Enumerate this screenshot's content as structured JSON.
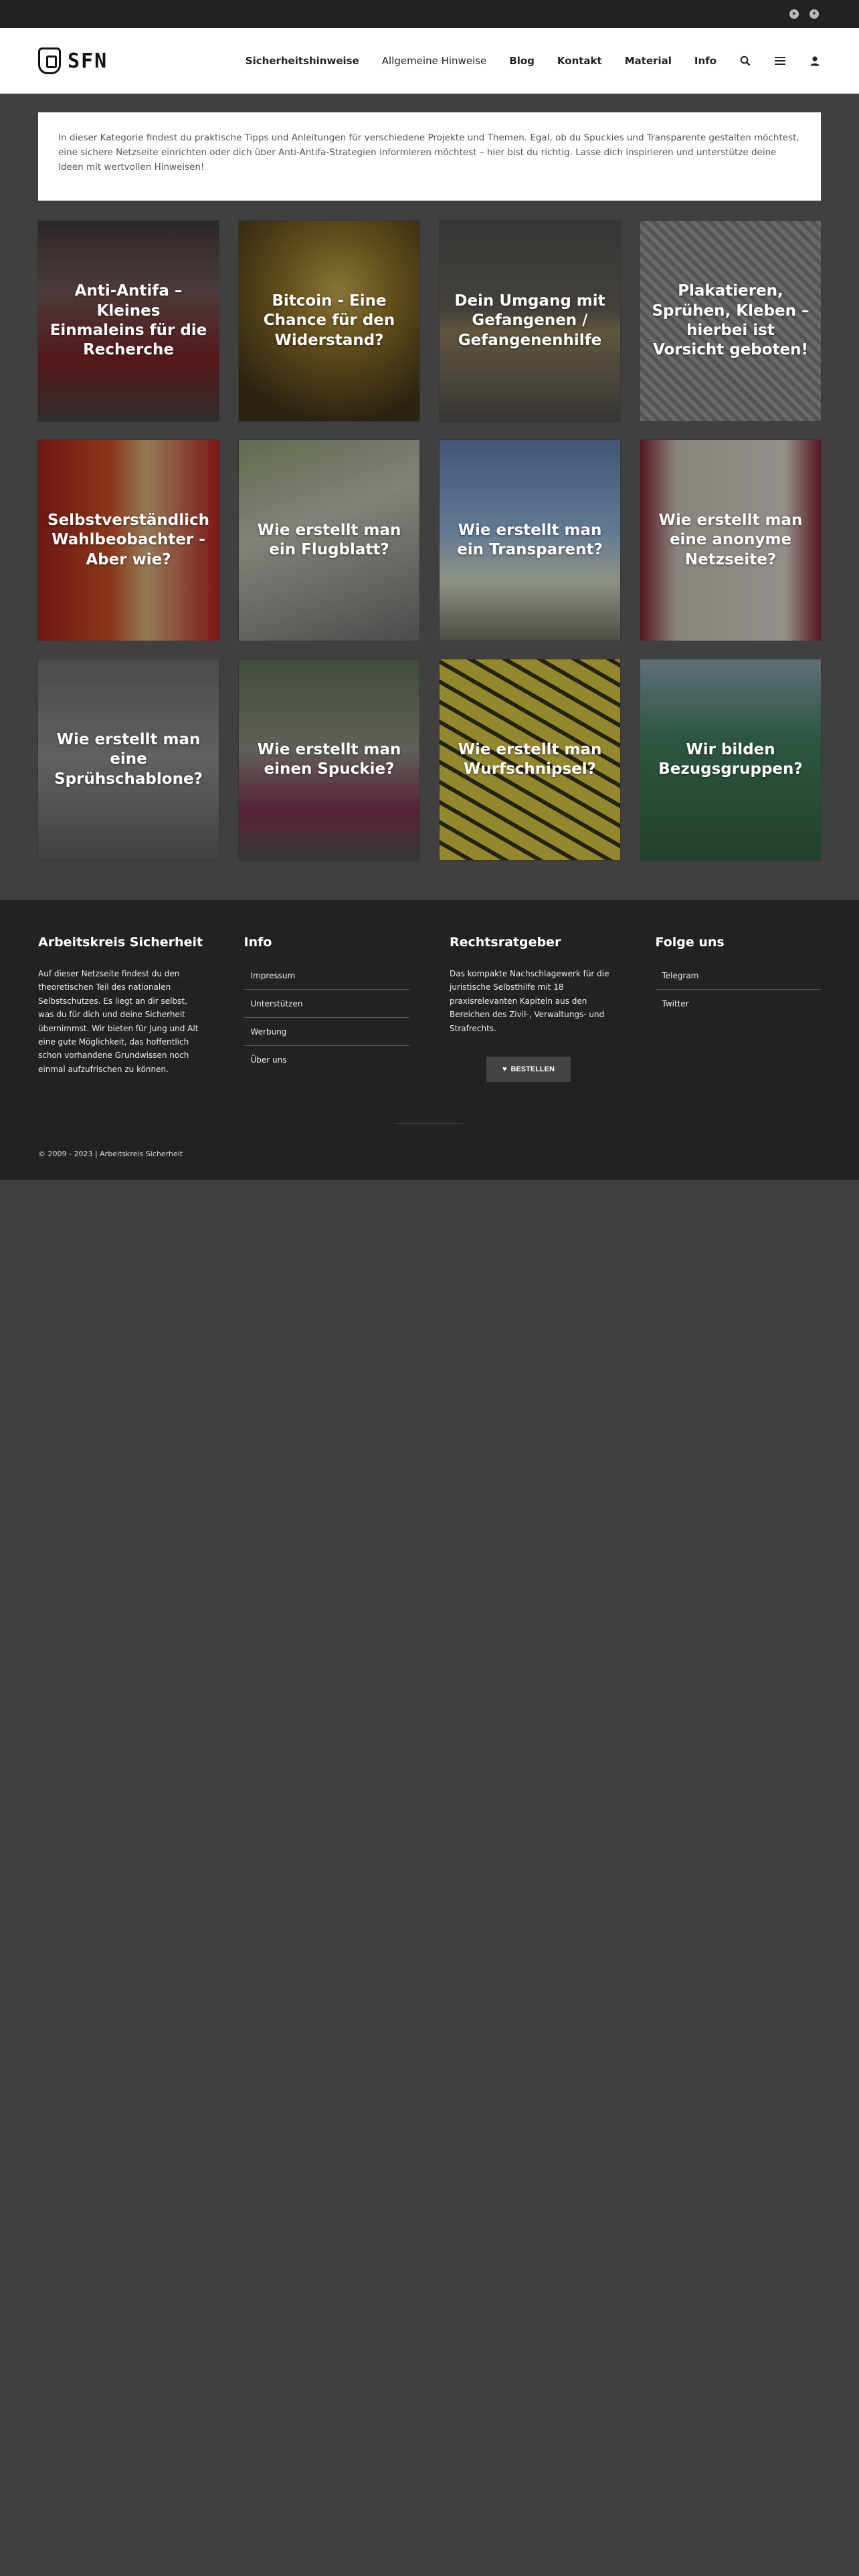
{
  "topbar": {
    "icons": [
      "telegram-icon",
      "twitter-icon"
    ]
  },
  "header": {
    "logo_text": "SFN",
    "nav": [
      {
        "label": "Sicherheitshinweise",
        "bold": true
      },
      {
        "label": "Allgemeine Hinweise",
        "bold": false
      },
      {
        "label": "Blog",
        "bold": true
      },
      {
        "label": "Kontakt",
        "bold": true
      },
      {
        "label": "Material",
        "bold": true
      },
      {
        "label": "Info",
        "bold": true
      }
    ],
    "icons": [
      "search-icon",
      "menu-icon",
      "user-icon"
    ]
  },
  "intro": {
    "text": "In dieser Kategorie findest du praktische Tipps und Anleitungen für verschiedene Projekte und Themen. Egal, ob du Spuckies und Transparente gestalten möchtest, eine sichere Netzseite einrichten oder dich über Anti-Antifa-Strategien informieren möchtest – hier bist du richtig. Lasse dich inspirieren und unterstütze deine Ideen mit wertvollen Hinweisen!"
  },
  "cards": [
    {
      "title": "Anti-Antifa – Kleines Einmaleins für die Recherche"
    },
    {
      "title": "Bitcoin - Eine Chance für den Widerstand?"
    },
    {
      "title": "Dein Umgang mit Gefangenen / Gefangenenhilfe"
    },
    {
      "title": "Plakatieren, Sprühen, Kleben – hierbei ist Vorsicht geboten!"
    },
    {
      "title": "Selbstverständlich Wahlbeobachter - Aber wie?"
    },
    {
      "title": "Wie erstellt man ein Flugblatt?"
    },
    {
      "title": "Wie erstellt man ein Transparent?"
    },
    {
      "title": "Wie erstellt man eine anonyme Netzseite?"
    },
    {
      "title": "Wie erstellt man eine Sprühschablone?"
    },
    {
      "title": "Wie erstellt man einen Spuckie?"
    },
    {
      "title": "Wie erstellt man Wurfschnipsel?"
    },
    {
      "title": "Wir bilden Bezugsgruppen?"
    }
  ],
  "footer": {
    "col1": {
      "heading": "Arbeitskreis Sicherheit",
      "text": "Auf dieser Netzseite findest du den theoretischen Teil des nationalen Selbstschutzes. Es liegt an dir selbst, was du für dich und deine Sicherheit übernimmst. Wir bieten für Jung und Alt eine gute Möglichkeit, das hoffentlich schon vorhandene Grundwissen noch einmal aufzufrischen zu können."
    },
    "col2": {
      "heading": "Info",
      "links": [
        "Impressum",
        "Unterstützen",
        "Werbung",
        "Über uns"
      ]
    },
    "col3": {
      "heading": "Rechtsratgeber",
      "text": "Das kompakte Nachschlagewerk für die juristische Selbsthilfe mit 18 praxisrelevanten Kapiteln aus den Bereichen des Zivil-, Verwaltungs- und Strafrechts.",
      "button": "BESTELLEN"
    },
    "col4": {
      "heading": "Folge uns",
      "links": [
        "Telegram",
        "Twitter"
      ]
    },
    "copyright": "© 2009 - 2023 | Arbeitskreis Sicherheit"
  }
}
